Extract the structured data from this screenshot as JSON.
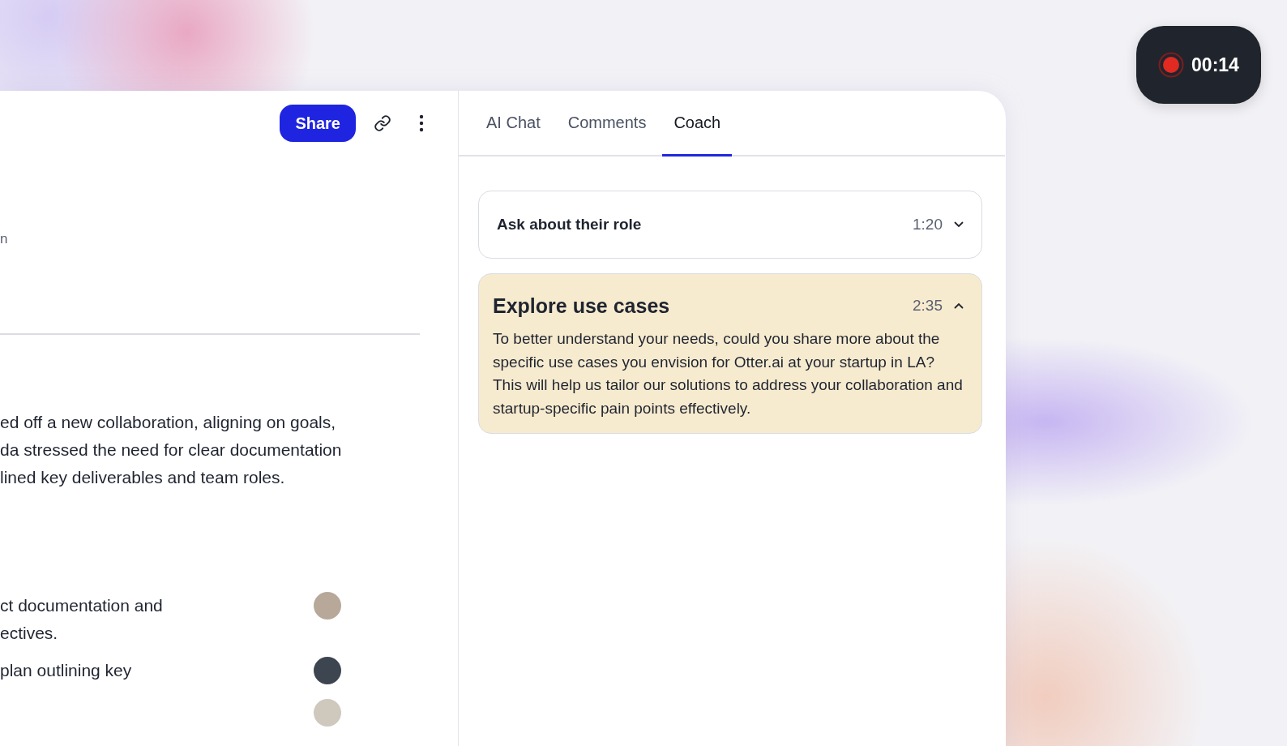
{
  "header": {
    "share_button": "Share"
  },
  "summary": {
    "fragment": "n",
    "paragraph_lines": [
      "ed off a new collaboration, aligning on goals,",
      "da stressed the need for clear documentation",
      "lined key deliverables and team roles."
    ]
  },
  "action_items": [
    {
      "lines": [
        "ct documentation and",
        "ectives."
      ]
    },
    {
      "lines": [
        "plan outlining key"
      ]
    }
  ],
  "tabs": [
    {
      "label": "AI Chat",
      "selected": false
    },
    {
      "label": "Comments",
      "selected": false
    },
    {
      "label": "Coach",
      "selected": true
    }
  ],
  "coach_cards": [
    {
      "title": "Ask about their role",
      "time": "1:20",
      "expanded": false
    },
    {
      "title": "Explore use cases",
      "time": "2:35",
      "expanded": true,
      "body": "To better understand your needs, could you share more about the specific use cases you envision for Otter.ai at your startup in LA? This will help us tailor our solutions to address your collaboration and startup-specific pain points effectively."
    }
  ],
  "recorder": {
    "time": "00:14",
    "recording": true
  }
}
